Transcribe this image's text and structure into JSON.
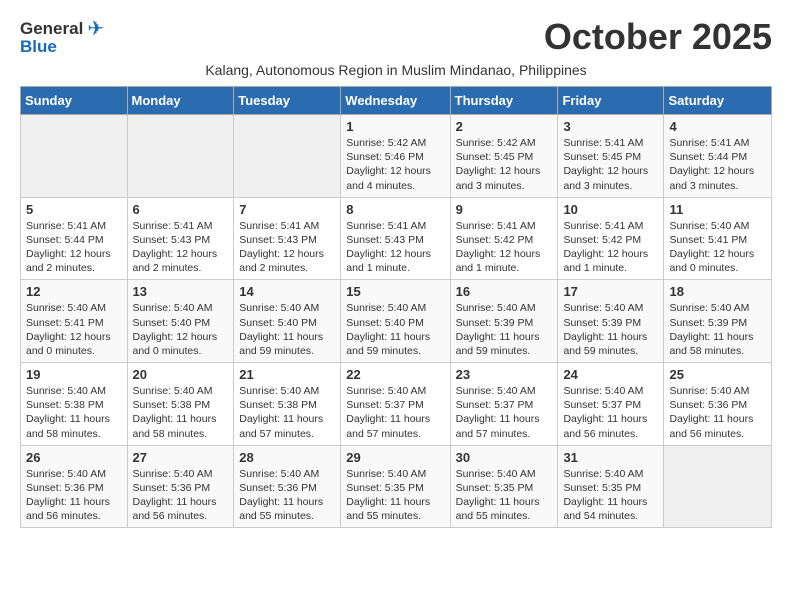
{
  "header": {
    "logo_general": "General",
    "logo_blue": "Blue",
    "month_title": "October 2025",
    "subtitle": "Kalang, Autonomous Region in Muslim Mindanao, Philippines"
  },
  "days_of_week": [
    "Sunday",
    "Monday",
    "Tuesday",
    "Wednesday",
    "Thursday",
    "Friday",
    "Saturday"
  ],
  "weeks": [
    [
      {
        "day": "",
        "info": ""
      },
      {
        "day": "",
        "info": ""
      },
      {
        "day": "",
        "info": ""
      },
      {
        "day": "1",
        "info": "Sunrise: 5:42 AM\nSunset: 5:46 PM\nDaylight: 12 hours\nand 4 minutes."
      },
      {
        "day": "2",
        "info": "Sunrise: 5:42 AM\nSunset: 5:45 PM\nDaylight: 12 hours\nand 3 minutes."
      },
      {
        "day": "3",
        "info": "Sunrise: 5:41 AM\nSunset: 5:45 PM\nDaylight: 12 hours\nand 3 minutes."
      },
      {
        "day": "4",
        "info": "Sunrise: 5:41 AM\nSunset: 5:44 PM\nDaylight: 12 hours\nand 3 minutes."
      }
    ],
    [
      {
        "day": "5",
        "info": "Sunrise: 5:41 AM\nSunset: 5:44 PM\nDaylight: 12 hours\nand 2 minutes."
      },
      {
        "day": "6",
        "info": "Sunrise: 5:41 AM\nSunset: 5:43 PM\nDaylight: 12 hours\nand 2 minutes."
      },
      {
        "day": "7",
        "info": "Sunrise: 5:41 AM\nSunset: 5:43 PM\nDaylight: 12 hours\nand 2 minutes."
      },
      {
        "day": "8",
        "info": "Sunrise: 5:41 AM\nSunset: 5:43 PM\nDaylight: 12 hours\nand 1 minute."
      },
      {
        "day": "9",
        "info": "Sunrise: 5:41 AM\nSunset: 5:42 PM\nDaylight: 12 hours\nand 1 minute."
      },
      {
        "day": "10",
        "info": "Sunrise: 5:41 AM\nSunset: 5:42 PM\nDaylight: 12 hours\nand 1 minute."
      },
      {
        "day": "11",
        "info": "Sunrise: 5:40 AM\nSunset: 5:41 PM\nDaylight: 12 hours\nand 0 minutes."
      }
    ],
    [
      {
        "day": "12",
        "info": "Sunrise: 5:40 AM\nSunset: 5:41 PM\nDaylight: 12 hours\nand 0 minutes."
      },
      {
        "day": "13",
        "info": "Sunrise: 5:40 AM\nSunset: 5:40 PM\nDaylight: 12 hours\nand 0 minutes."
      },
      {
        "day": "14",
        "info": "Sunrise: 5:40 AM\nSunset: 5:40 PM\nDaylight: 11 hours\nand 59 minutes."
      },
      {
        "day": "15",
        "info": "Sunrise: 5:40 AM\nSunset: 5:40 PM\nDaylight: 11 hours\nand 59 minutes."
      },
      {
        "day": "16",
        "info": "Sunrise: 5:40 AM\nSunset: 5:39 PM\nDaylight: 11 hours\nand 59 minutes."
      },
      {
        "day": "17",
        "info": "Sunrise: 5:40 AM\nSunset: 5:39 PM\nDaylight: 11 hours\nand 59 minutes."
      },
      {
        "day": "18",
        "info": "Sunrise: 5:40 AM\nSunset: 5:39 PM\nDaylight: 11 hours\nand 58 minutes."
      }
    ],
    [
      {
        "day": "19",
        "info": "Sunrise: 5:40 AM\nSunset: 5:38 PM\nDaylight: 11 hours\nand 58 minutes."
      },
      {
        "day": "20",
        "info": "Sunrise: 5:40 AM\nSunset: 5:38 PM\nDaylight: 11 hours\nand 58 minutes."
      },
      {
        "day": "21",
        "info": "Sunrise: 5:40 AM\nSunset: 5:38 PM\nDaylight: 11 hours\nand 57 minutes."
      },
      {
        "day": "22",
        "info": "Sunrise: 5:40 AM\nSunset: 5:37 PM\nDaylight: 11 hours\nand 57 minutes."
      },
      {
        "day": "23",
        "info": "Sunrise: 5:40 AM\nSunset: 5:37 PM\nDaylight: 11 hours\nand 57 minutes."
      },
      {
        "day": "24",
        "info": "Sunrise: 5:40 AM\nSunset: 5:37 PM\nDaylight: 11 hours\nand 56 minutes."
      },
      {
        "day": "25",
        "info": "Sunrise: 5:40 AM\nSunset: 5:36 PM\nDaylight: 11 hours\nand 56 minutes."
      }
    ],
    [
      {
        "day": "26",
        "info": "Sunrise: 5:40 AM\nSunset: 5:36 PM\nDaylight: 11 hours\nand 56 minutes."
      },
      {
        "day": "27",
        "info": "Sunrise: 5:40 AM\nSunset: 5:36 PM\nDaylight: 11 hours\nand 56 minutes."
      },
      {
        "day": "28",
        "info": "Sunrise: 5:40 AM\nSunset: 5:36 PM\nDaylight: 11 hours\nand 55 minutes."
      },
      {
        "day": "29",
        "info": "Sunrise: 5:40 AM\nSunset: 5:35 PM\nDaylight: 11 hours\nand 55 minutes."
      },
      {
        "day": "30",
        "info": "Sunrise: 5:40 AM\nSunset: 5:35 PM\nDaylight: 11 hours\nand 55 minutes."
      },
      {
        "day": "31",
        "info": "Sunrise: 5:40 AM\nSunset: 5:35 PM\nDaylight: 11 hours\nand 54 minutes."
      },
      {
        "day": "",
        "info": ""
      }
    ]
  ]
}
